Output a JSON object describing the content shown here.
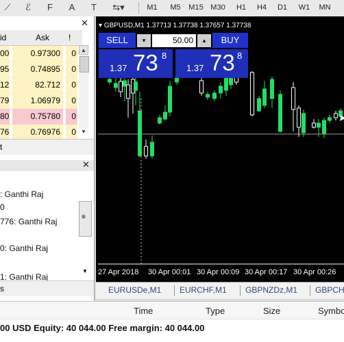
{
  "toolbar": {
    "timeframes": [
      "M1",
      "M5",
      "M15",
      "M30",
      "H1",
      "H4",
      "D1",
      "W1",
      "MN"
    ]
  },
  "market_watch": {
    "col_bid": "id",
    "col_ask": "Ask",
    "col_excl": "!",
    "rows": [
      {
        "bid": "00",
        "ask": "0.97300",
        "spread": "0",
        "highlight": "#fdf3c2"
      },
      {
        "bid": "95",
        "ask": "0.74895",
        "spread": "0",
        "highlight": "#fdf3c2"
      },
      {
        "bid": "12",
        "ask": "82.712",
        "spread": "0",
        "highlight": "#fdf3c2"
      },
      {
        "bid": "79",
        "ask": "1.06979",
        "spread": "0",
        "highlight": "#fdf3c2"
      },
      {
        "bid": "80",
        "ask": "0.75780",
        "spread": "0",
        "highlight": "#f9c9d0"
      },
      {
        "bid": "76",
        "ask": "0.76976",
        "spread": "0",
        "highlight": "#fdf3c2"
      }
    ],
    "tab_label": "t"
  },
  "journal": {
    "lines": [
      ": Ganthi Raj",
      "0",
      "776: Ganthi Raj",
      "0: Ganthi Raj",
      "1: Ganthi Raj"
    ],
    "footer": "s"
  },
  "chart": {
    "header": "GBPUSD,M1  1.37713 1.37738 1.37657 1.37738",
    "sell_label": "SELL",
    "buy_label": "BUY",
    "lot": "50.00",
    "sell_price_small": "1.37",
    "sell_price_big": "73",
    "sell_price_sup": "8",
    "buy_price_small": "1.37",
    "buy_price_big": "73",
    "buy_price_sup": "8",
    "time_labels": [
      "27 Apr 2018",
      "30 Apr 00:01",
      "30 Apr 00:09",
      "30 Apr 00:17",
      "30 Apr 00:26"
    ],
    "bull_color": "#22dd66",
    "line_color": "#ffffff"
  },
  "symbol_tabs": [
    "EURUSDe,M1",
    "EURCHF,M1",
    "GBPNZDz,M1",
    "GBPCH"
  ],
  "terminal": {
    "headers": [
      "Time",
      "Type",
      "Size",
      "Symbo"
    ],
    "status": "00 USD  Equity: 40 044.00  Free margin: 40 044.00"
  }
}
